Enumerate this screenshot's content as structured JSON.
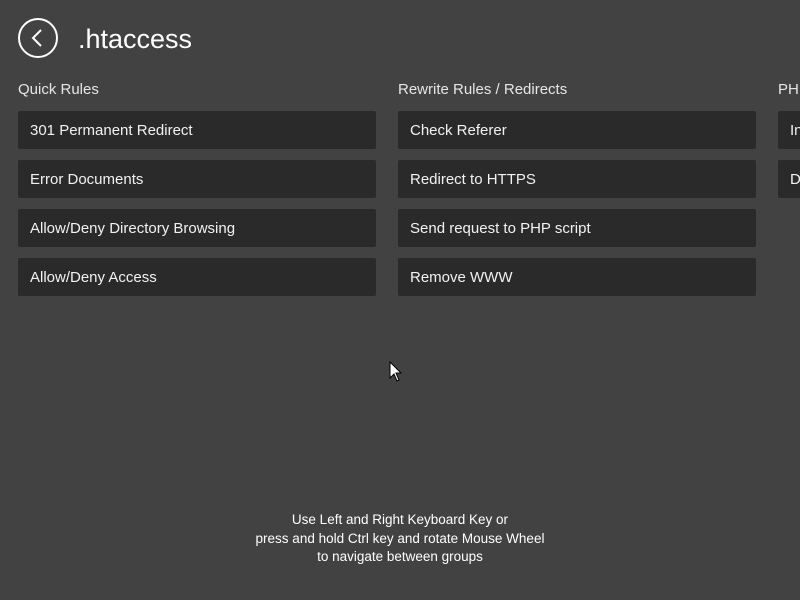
{
  "page": {
    "title": ".htaccess",
    "back_icon": "chevron-left-icon"
  },
  "groups": [
    {
      "header": "Quick Rules",
      "items": [
        {
          "label": "301 Permanent Redirect"
        },
        {
          "label": "Error Documents"
        },
        {
          "label": "Allow/Deny Directory Browsing"
        },
        {
          "label": "Allow/Deny Access"
        }
      ]
    },
    {
      "header": "Rewrite Rules / Redirects",
      "items": [
        {
          "label": "Check Referer"
        },
        {
          "label": "Redirect to HTTPS"
        },
        {
          "label": "Send request to PHP script"
        },
        {
          "label": "Remove WWW"
        }
      ]
    },
    {
      "header": "PHP",
      "items": [
        {
          "label": "In"
        },
        {
          "label": "D"
        }
      ]
    }
  ],
  "hint": {
    "line1": "Use Left and Right Keyboard Key or",
    "line2": "press and hold Ctrl key and rotate Mouse Wheel",
    "line3": "to navigate between groups"
  },
  "colors": {
    "background": "#424242",
    "tile": "#2a2a2a",
    "text": "#ffffff"
  }
}
